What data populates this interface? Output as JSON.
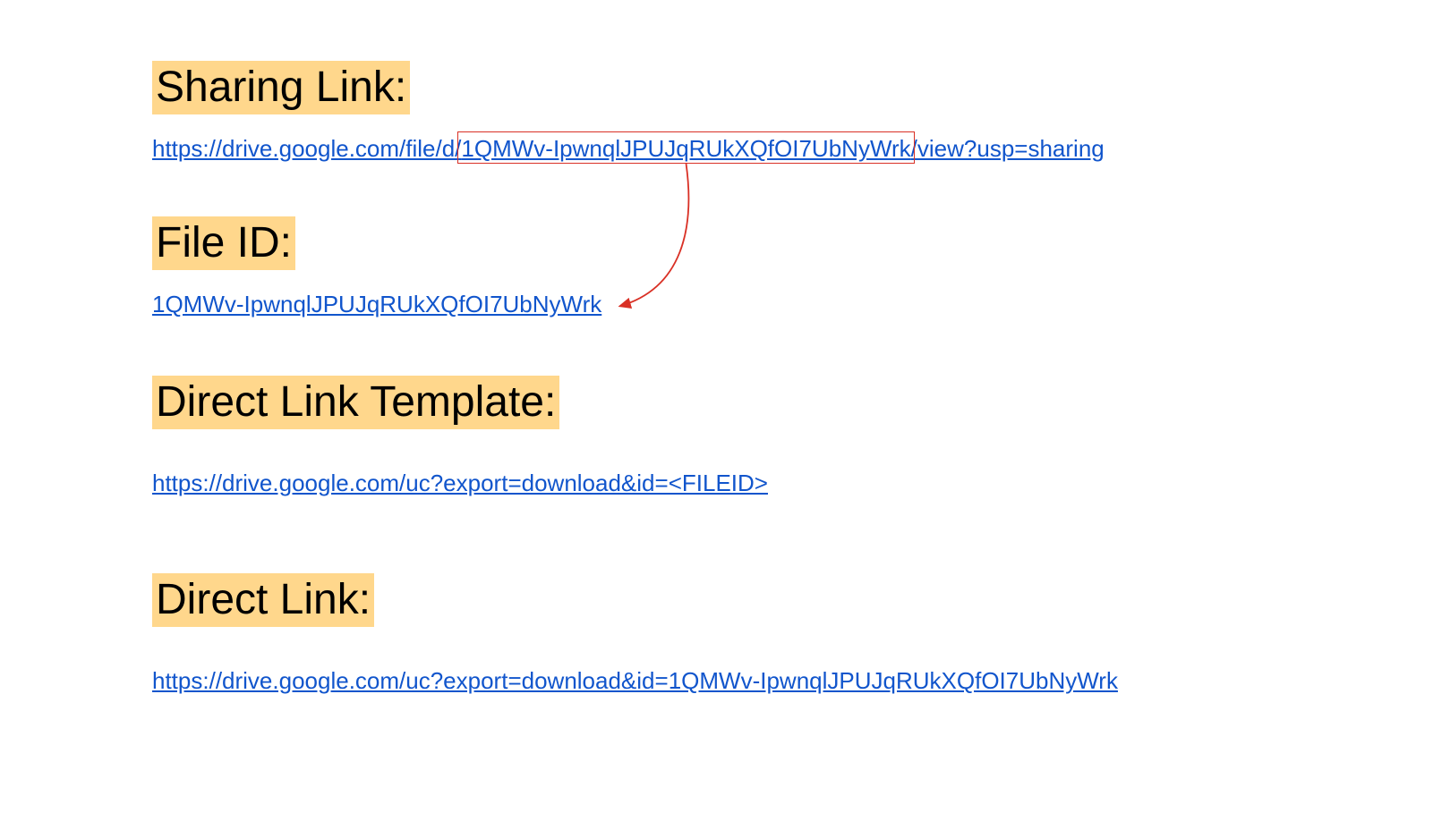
{
  "sections": {
    "sharing": {
      "heading": "Sharing Link:",
      "url_part1": "https://drive.google.com/file/d/",
      "url_fileid": "1QMWv-IpwnqlJPUJqRUkXQfOI7UbNyWrk",
      "url_part2": "/view?usp=sharing"
    },
    "fileid": {
      "heading": "File ID:",
      "value": "1QMWv-IpwnqlJPUJqRUkXQfOI7UbNyWrk"
    },
    "template": {
      "heading": "Direct Link Template:",
      "url": "https://drive.google.com/uc?export=download&id=<FILEID>"
    },
    "direct": {
      "heading": "Direct Link:",
      "url": "https://drive.google.com/uc?export=download&id=1QMWv-IpwnqlJPUJqRUkXQfOI7UbNyWrk"
    }
  },
  "annotation": {
    "box_color": "#d93025",
    "arrow_color": "#d93025"
  }
}
